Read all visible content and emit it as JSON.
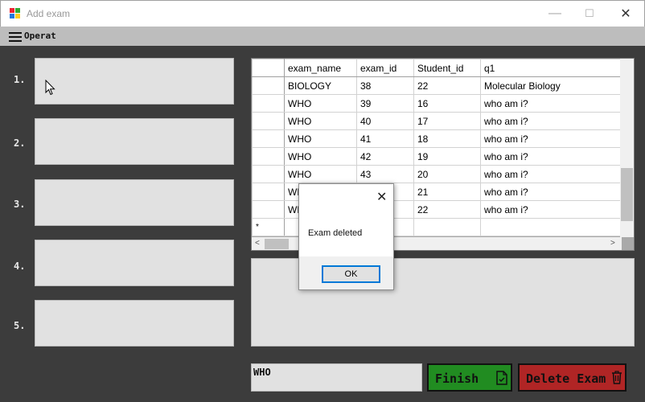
{
  "window": {
    "title": "Add exam",
    "minimize_glyph": "—",
    "maximize_glyph": "☐",
    "close_glyph": "✕"
  },
  "menu": {
    "label": "Operat"
  },
  "answers": {
    "numbers": [
      "1.",
      "2.",
      "3.",
      "4.",
      "5."
    ]
  },
  "grid": {
    "columns": [
      "exam_name",
      "exam_id",
      "Student_id",
      "q1"
    ],
    "rows": [
      [
        "BIOLOGY",
        "38",
        "22",
        "Molecular Biology"
      ],
      [
        "WHO",
        "39",
        "16",
        "who am i?"
      ],
      [
        "WHO",
        "40",
        "17",
        "who am i?"
      ],
      [
        "WHO",
        "41",
        "18",
        "who am i?"
      ],
      [
        "WHO",
        "42",
        "19",
        "who am i?"
      ],
      [
        "WHO",
        "43",
        "20",
        "who am i?"
      ],
      [
        "WHO",
        "",
        "21",
        "who am i?"
      ],
      [
        "WHO",
        "",
        "22",
        "who am i?"
      ]
    ],
    "new_row_marker": "*",
    "scroll_left": "<",
    "scroll_right": ">"
  },
  "exam_name_field": {
    "value": "WHO"
  },
  "buttons": {
    "finish": "Finish",
    "delete": "Delete Exam"
  },
  "dialog": {
    "message": "Exam deleted",
    "ok": "OK",
    "close_glyph": "✕"
  },
  "colors": {
    "finish_bg": "#218c21",
    "delete_bg": "#b02525",
    "background": "#3c3c3c"
  }
}
